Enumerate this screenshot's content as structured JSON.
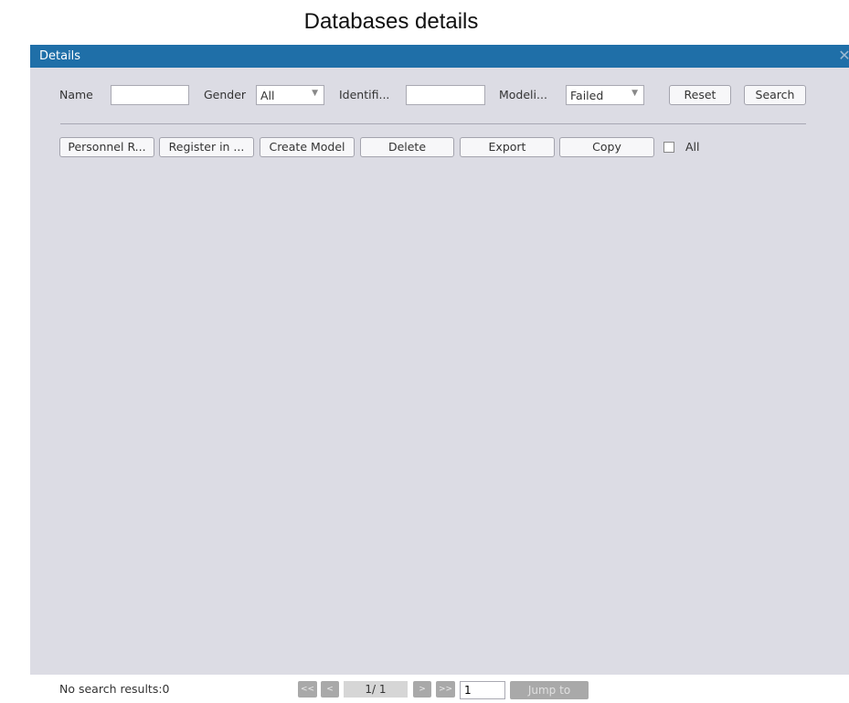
{
  "page": {
    "title": "Databases details"
  },
  "dialog": {
    "title": "Details",
    "close_icon": "close-icon"
  },
  "filters": {
    "name_label": "Name",
    "name_value": "",
    "gender_label": "Gender",
    "gender_value": "All",
    "identification_label": "Identifi...",
    "identification_value": "",
    "modeling_label": "Modeli...",
    "modeling_value": "Failed",
    "reset_label": "Reset",
    "search_label": "Search"
  },
  "toolbar": {
    "personnel_label": "Personnel R...",
    "register_label": "Register in ...",
    "create_model_label": "Create Model",
    "delete_label": "Delete",
    "export_label": "Export",
    "copy_label": "Copy",
    "all_label": "All",
    "all_checked": false
  },
  "footer": {
    "status": "No search results:0",
    "first_label": "<<",
    "prev_label": "<",
    "page_info": "1/ 1",
    "next_label": ">",
    "last_label": ">>",
    "page_input": "1",
    "jump_label": "Jump to"
  },
  "colors": {
    "header_bg": "#1f6fa8",
    "dialog_bg": "#dcdce4",
    "disabled_button": "#a9a9a9"
  }
}
